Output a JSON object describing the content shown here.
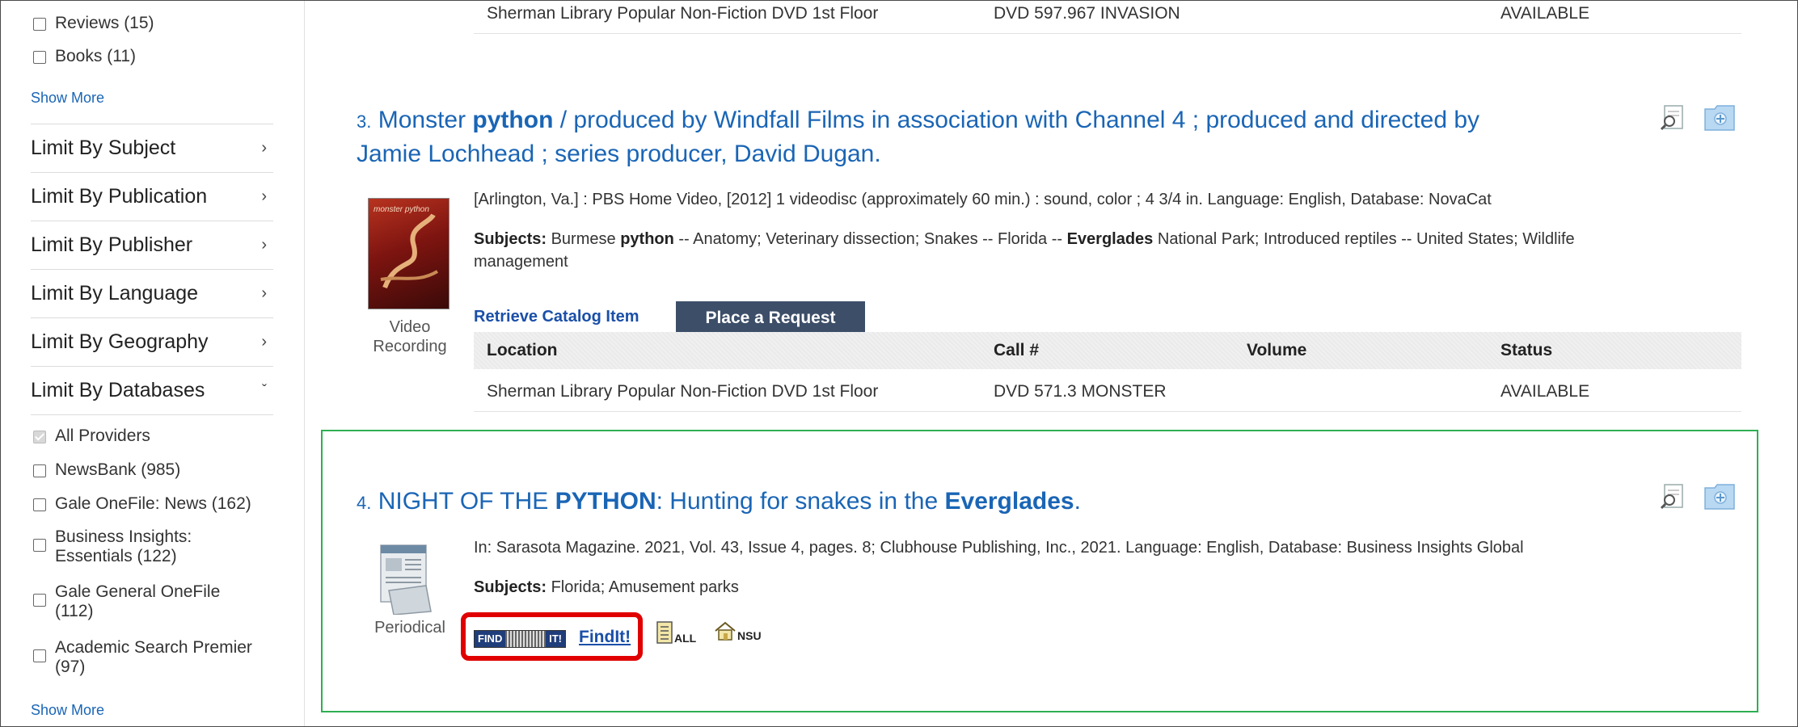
{
  "sidebar": {
    "top_facets": [
      {
        "label": "Reviews (15)",
        "checked": false
      },
      {
        "label": "Books (11)",
        "checked": false
      }
    ],
    "show_more_1": "Show More",
    "limits": [
      {
        "label": "Limit By Subject",
        "chevron": "chevron-right-icon"
      },
      {
        "label": "Limit By Publication",
        "chevron": "chevron-right-icon"
      },
      {
        "label": "Limit By Publisher",
        "chevron": "chevron-right-icon"
      },
      {
        "label": "Limit By Language",
        "chevron": "chevron-right-icon"
      },
      {
        "label": "Limit By Geography",
        "chevron": "chevron-right-icon"
      },
      {
        "label": "Limit By Databases",
        "chevron": "chevron-down-icon"
      }
    ],
    "databases": [
      {
        "label": "All Providers",
        "checked": true
      },
      {
        "label": "NewsBank (985)",
        "checked": false
      },
      {
        "label": "Gale OneFile: News (162)",
        "checked": false
      },
      {
        "label_line1": "Business Insights:",
        "label_line2": "Essentials (122)",
        "checked": false
      },
      {
        "label_line1": "Gale General OneFile",
        "label_line2": "(112)",
        "checked": false
      },
      {
        "label_line1": "Academic Search Premier",
        "label_line2": "(97)",
        "checked": false
      }
    ],
    "show_more_2": "Show More"
  },
  "prev_result_holding": {
    "location": "Sherman Library Popular Non-Fiction DVD 1st Floor",
    "call": "DVD 597.967 INVASION",
    "status": "AVAILABLE"
  },
  "result3": {
    "number": "3.",
    "title_part1": "Monster ",
    "title_bold": "python",
    "title_part2": " / produced by Windfall Films in association with Channel 4 ; produced and directed by",
    "title_line2": "Jamie Lochhead ; series producer, David Dugan.",
    "description": "[Arlington, Va.] : PBS Home Video, [2012] 1 videodisc (approximately 60 min.) : sound, color ; 4 3/4 in. Language: English, Database: NovaCat",
    "subjects_label": "Subjects:",
    "subjects_a": " Burmese ",
    "subjects_b_bold": "python",
    "subjects_c": " -- Anatomy; Veterinary dissection; Snakes -- Florida -- ",
    "subjects_d_bold": "Everglades",
    "subjects_e": " National Park; Introduced reptiles -- United States; Wildlife",
    "subjects_line2": "management",
    "thumb_title": "monster python",
    "thumb_caption_1": "Video",
    "thumb_caption_2": "Recording",
    "retrieve_label": "Retrieve Catalog Item",
    "request_label": "Place a Request",
    "table_headers": {
      "location": "Location",
      "call": "Call #",
      "volume": "Volume",
      "status": "Status"
    },
    "holding": {
      "location": "Sherman Library Popular Non-Fiction DVD 1st Floor",
      "call": "DVD 571.3 MONSTER",
      "status": "AVAILABLE"
    }
  },
  "result4": {
    "number": "4.",
    "title_part1": "NIGHT OF THE ",
    "title_bold1": "PYTHON",
    "title_part2": ": Hunting for snakes in the ",
    "title_bold2": "Everglades",
    "title_part3": ".",
    "description": "In: Sarasota Magazine. 2021, Vol. 43, Issue 4, pages. 8; Clubhouse Publishing, Inc., 2021. Language: English, Database: Business Insights Global",
    "subjects_label": "Subjects:",
    "subjects": " Florida; Amusement parks",
    "thumb_caption": "Periodical",
    "findit_logo_left": "FIND",
    "findit_logo_right": "IT!",
    "findit_label": "FindIt!",
    "lib_all": "ALL",
    "lib_nsu": "NSU"
  },
  "colors": {
    "link": "#1a65b5",
    "highlight_green": "#2fae52",
    "highlight_red": "#e00000",
    "request_button": "#3d4e68"
  }
}
